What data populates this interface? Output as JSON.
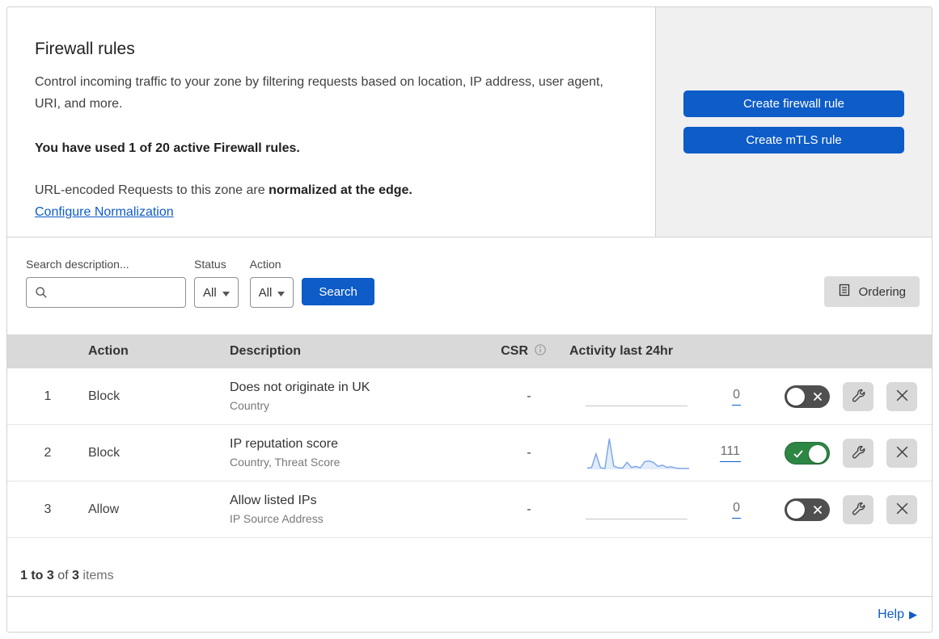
{
  "colors": {
    "accent": "#0d5cc8",
    "toggle_on": "#2e8644",
    "toggle_on_border": "#236c35",
    "toggle_off": "#4f4f4f",
    "spark_stroke": "#78a4e8",
    "spark_fill": "#e2ecfa"
  },
  "header": {
    "title": "Firewall rules",
    "description": "Control incoming traffic to your zone by filtering requests based on location, IP address, user agent, URI, and more.",
    "usage_bold": "You have used 1 of 20 active Firewall rules.",
    "normalization_prefix": "URL-encoded Requests to this zone are ",
    "normalization_bold": "normalized at the edge.",
    "normalization_link": "Configure Normalization",
    "create_firewall_button": "Create firewall rule",
    "create_mtls_button": "Create mTLS rule"
  },
  "filters": {
    "search_label": "Search description...",
    "status_label": "Status",
    "status_value": "All",
    "action_label": "Action",
    "action_value": "All",
    "search_button": "Search",
    "ordering_button": "Ordering"
  },
  "table": {
    "columns": {
      "action": "Action",
      "description": "Description",
      "csr": "CSR",
      "activity": "Activity last 24hr"
    },
    "rows": [
      {
        "priority": "1",
        "action": "Block",
        "description": "Does not originate in UK",
        "criteria": "Country",
        "csr": "-",
        "activity_count": "0",
        "activity_values": null,
        "enabled": false
      },
      {
        "priority": "2",
        "action": "Block",
        "description": "IP reputation score",
        "criteria": "Country, Threat Score",
        "csr": "-",
        "activity_count": "111",
        "activity_values": [
          4,
          6,
          48,
          5,
          3,
          95,
          10,
          5,
          4,
          22,
          6,
          9,
          5,
          24,
          26,
          21,
          9,
          13,
          6,
          8,
          4,
          3,
          3,
          3
        ],
        "enabled": true
      },
      {
        "priority": "3",
        "action": "Allow",
        "description": "Allow listed IPs",
        "criteria": "IP Source Address",
        "csr": "-",
        "activity_count": "0",
        "activity_values": null,
        "enabled": false
      }
    ]
  },
  "footer": {
    "range": "1 to 3",
    "of": " of ",
    "total": "3",
    "items": " items",
    "help": "Help"
  }
}
